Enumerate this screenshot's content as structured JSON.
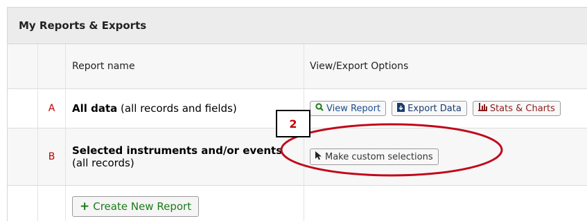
{
  "panel": {
    "title": "My Reports & Exports"
  },
  "table": {
    "columns": [
      "",
      "",
      "Report name",
      "View/Export Options"
    ],
    "rows": [
      {
        "letter": "A",
        "name_bold": "All data",
        "name_rest": " (all records and fields)",
        "buttons": {
          "view": "View Report",
          "export": "Export Data",
          "stats": "Stats & Charts"
        }
      },
      {
        "letter": "B",
        "name_bold": "Selected instruments and/or events",
        "name_rest": "(all records)",
        "custom_button": "Make custom selections"
      }
    ],
    "create_button": "Create New Report"
  },
  "callout": {
    "number": "2",
    "color": "#c00000"
  },
  "colors": {
    "header_bg": "#ececec",
    "accent_red": "#c00000",
    "green": "#1a7a1a",
    "annotation_ellipse": "#c0081a"
  }
}
